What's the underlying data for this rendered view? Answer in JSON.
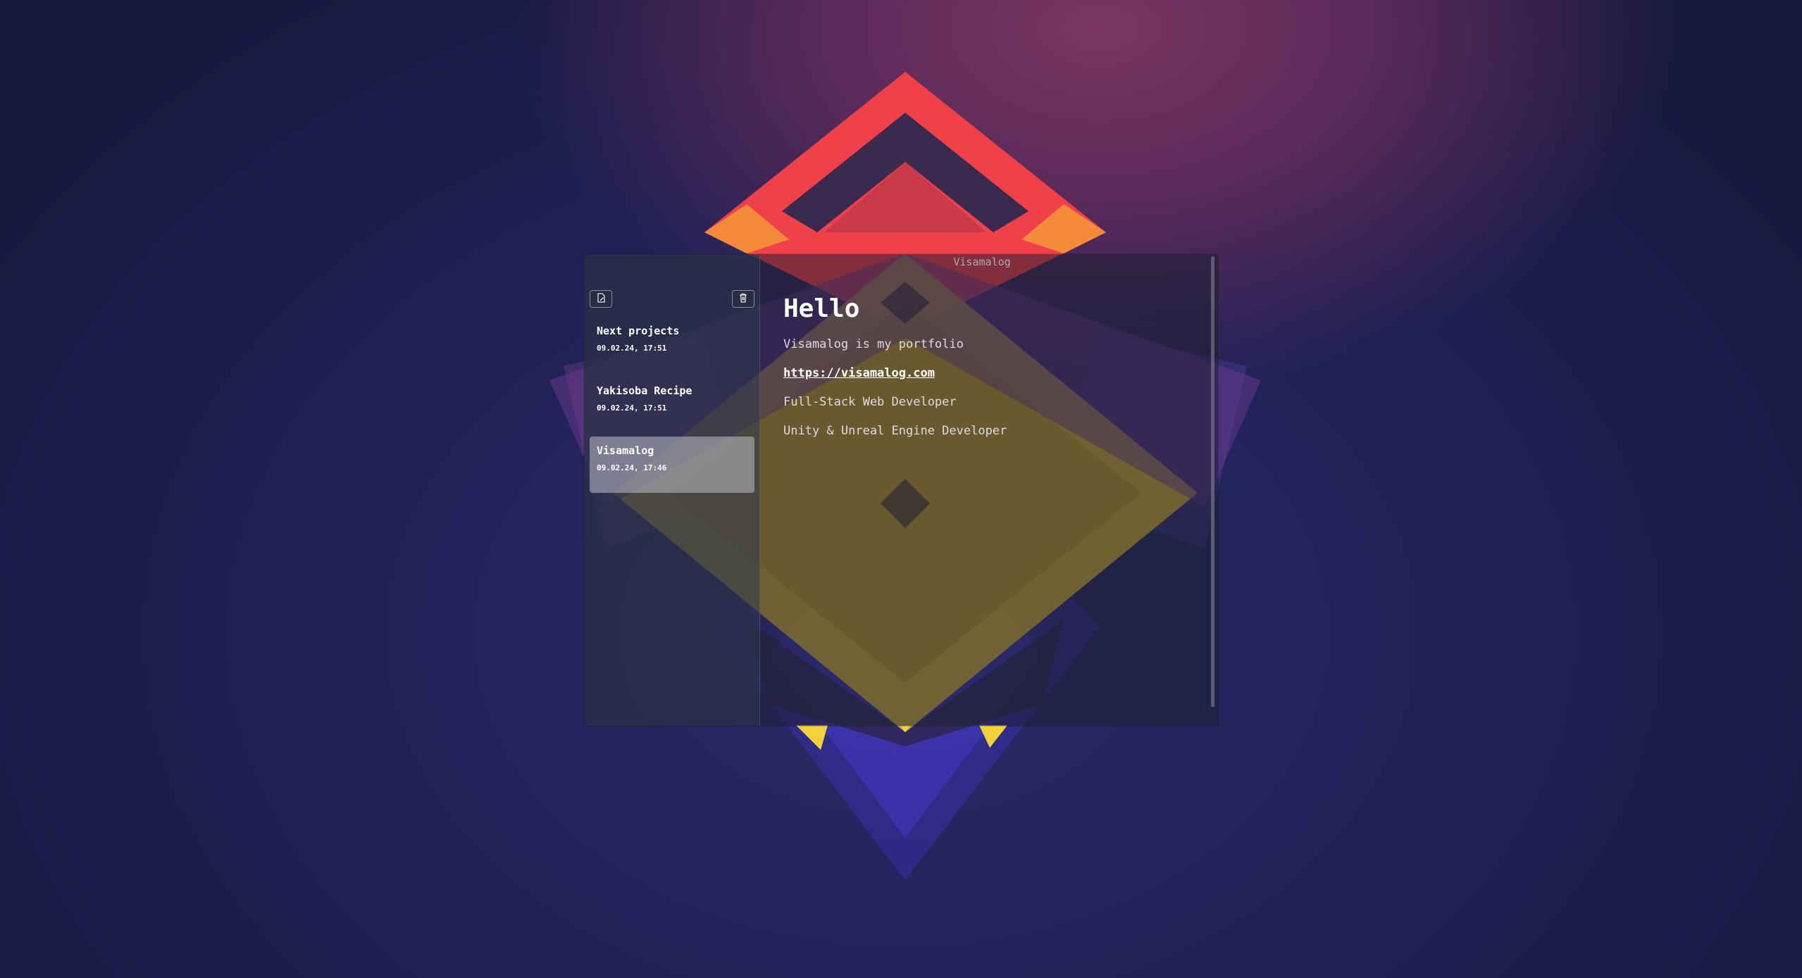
{
  "window": {
    "title": "Visamalog"
  },
  "sidebar": {
    "new_note_icon": "new-note-icon",
    "delete_icon": "trash-icon",
    "notes": [
      {
        "title": "Next projects",
        "date": "09.02.24, 17:51",
        "selected": false
      },
      {
        "title": "Yakisoba Recipe",
        "date": "09.02.24, 17:51",
        "selected": false
      },
      {
        "title": "Visamalog",
        "date": "09.02.24, 17:46",
        "selected": true
      }
    ]
  },
  "editor": {
    "heading": "Hello",
    "line1": "Visamalog is my portfolio",
    "link": "https://visamalog.com",
    "line3": "Full-Stack Web Developer",
    "line4": "Unity & Unreal Engine Developer"
  },
  "colors": {
    "selected_item_bg": "#c0c0c8",
    "accent_red": "#f0404a",
    "accent_yellow": "#f2d23a",
    "background": "#1c1d4c"
  }
}
